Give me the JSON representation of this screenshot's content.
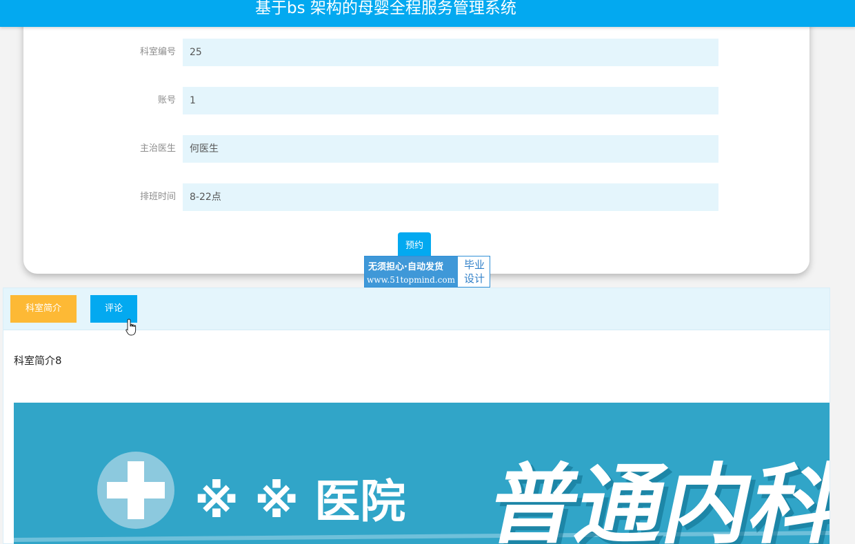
{
  "header": {
    "title": "基于bs 架构的母婴全程服务管理系统"
  },
  "form": {
    "fields": [
      {
        "label": "科室编号",
        "value": "25"
      },
      {
        "label": "账号",
        "value": "1"
      },
      {
        "label": "主治医生",
        "value": "何医生"
      },
      {
        "label": "排班时间",
        "value": "8-22点"
      }
    ],
    "book_button": "预约"
  },
  "watermark": {
    "line1": "无须担心·自动发货",
    "line2": "www.51topmind.com",
    "right_line1": "毕业",
    "right_line2": "设计"
  },
  "tabs": [
    {
      "label": "科室简介",
      "color": "#fdb935"
    },
    {
      "label": "评论",
      "color": "#03a9f0"
    }
  ],
  "content": {
    "intro_text": "科室简介8",
    "banner": {
      "hospital_name": "※ ※ 医院",
      "department": "普通内科",
      "background_color": "#31a5c8",
      "icon": "medical-cross-icon"
    }
  },
  "colors": {
    "primary": "#03a9f0",
    "accent": "#fdb935",
    "field_bg": "#e4f5fc"
  }
}
